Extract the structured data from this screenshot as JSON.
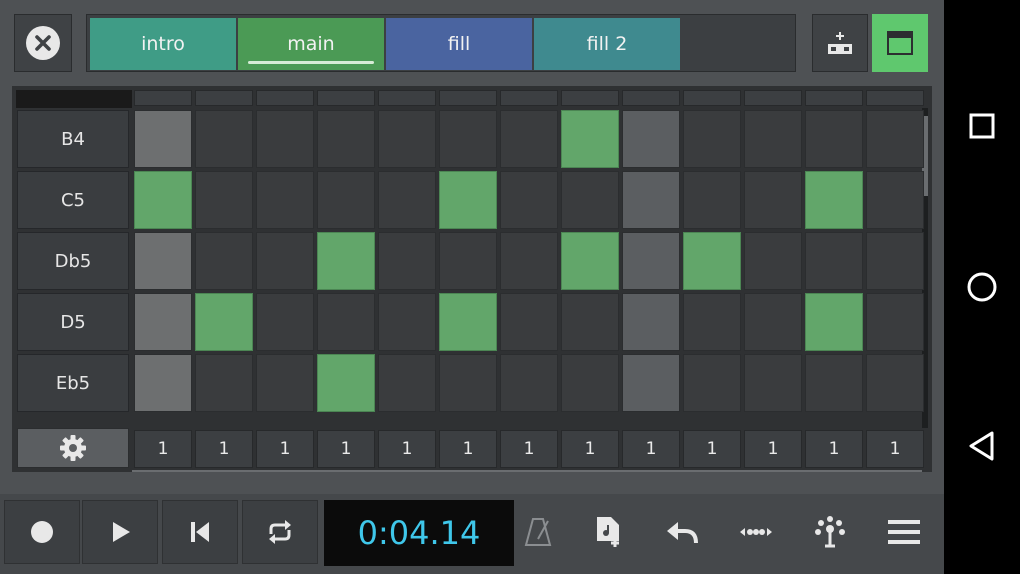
{
  "tabs": [
    {
      "label": "intro",
      "color": "#3f9c86",
      "active": false
    },
    {
      "label": "main",
      "color": "#4b9a55",
      "active": true
    },
    {
      "label": "fill",
      "color": "#4a64a0",
      "active": false
    },
    {
      "label": "fill 2",
      "color": "#3f8a8f",
      "active": false
    }
  ],
  "rows": [
    "B4",
    "C5",
    "Db5",
    "D5",
    "Eb5"
  ],
  "steps": [
    "1",
    "1",
    "1",
    "1",
    "1",
    "1",
    "1",
    "1",
    "1",
    "1",
    "1",
    "1",
    "1"
  ],
  "pattern": [
    [
      0,
      0,
      0,
      0,
      0,
      0,
      0,
      1,
      0,
      0,
      0,
      0,
      0
    ],
    [
      1,
      0,
      0,
      0,
      0,
      1,
      0,
      0,
      0,
      0,
      0,
      1,
      0
    ],
    [
      0,
      0,
      0,
      1,
      0,
      0,
      0,
      1,
      0,
      1,
      0,
      0,
      0
    ],
    [
      0,
      1,
      0,
      0,
      0,
      1,
      0,
      0,
      0,
      0,
      0,
      1,
      0
    ],
    [
      0,
      0,
      0,
      1,
      0,
      0,
      0,
      0,
      0,
      0,
      0,
      0,
      0
    ]
  ],
  "playhead_step": 0,
  "highlight_step": 8,
  "transport": {
    "time": "0:04.14"
  },
  "icons": {
    "close": "close-icon",
    "add_pattern": "add-pattern-icon",
    "view": "view-toggle-icon",
    "settings": "gear-icon",
    "record": "record-icon",
    "play": "play-icon",
    "rewind": "skip-back-icon",
    "loop": "loop-icon",
    "metronome": "metronome-icon",
    "new_file": "new-file-icon",
    "undo": "undo-icon",
    "dots": "dots-icon",
    "fx": "fx-icon",
    "menu": "menu-icon"
  },
  "colors": {
    "note_on": "#62a66a",
    "accent_green": "#5fc86e",
    "time_text": "#3fc7ea"
  }
}
